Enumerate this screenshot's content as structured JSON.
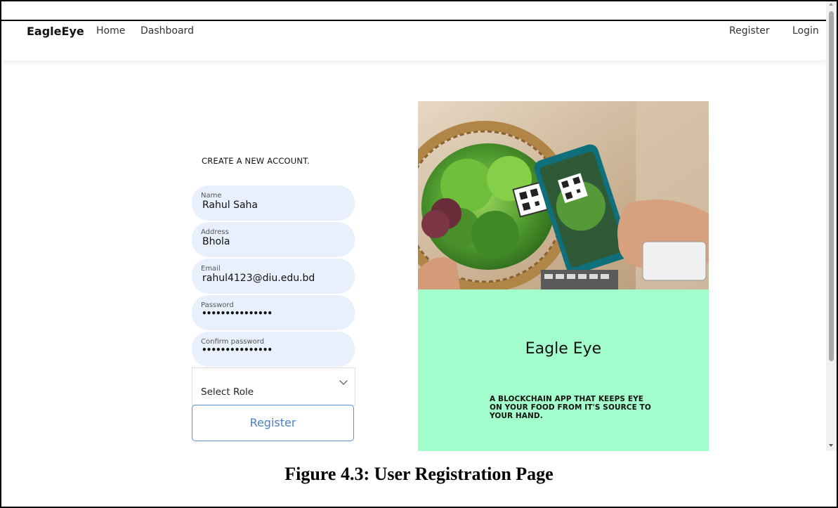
{
  "navbar": {
    "brand": "EagleEye",
    "home": "Home",
    "dashboard": "Dashboard",
    "register": "Register",
    "login": "Login"
  },
  "form": {
    "title": "CREATE A NEW ACCOUNT.",
    "fields": [
      {
        "label": "Name",
        "value": "Rahul Saha"
      },
      {
        "label": "Address",
        "value": "Bhola"
      },
      {
        "label": "Email",
        "value": "rahul4123@diu.edu.bd"
      },
      {
        "label": "Password",
        "value": "•••••••••••••••"
      },
      {
        "label": "Confirm password",
        "value": "•••••••••••••••"
      }
    ],
    "role_select": "Select Role",
    "submit": "Register"
  },
  "promo": {
    "title": "Eagle Eye",
    "tagline": "A BLOCKCHAIN APP THAT KEEPS EYE ON YOUR FOOD FROM IT'S SOURCE TO YOUR HAND.",
    "bg_color": "#a3fccc"
  },
  "caption": "Figure 4.3: User Registration Page"
}
